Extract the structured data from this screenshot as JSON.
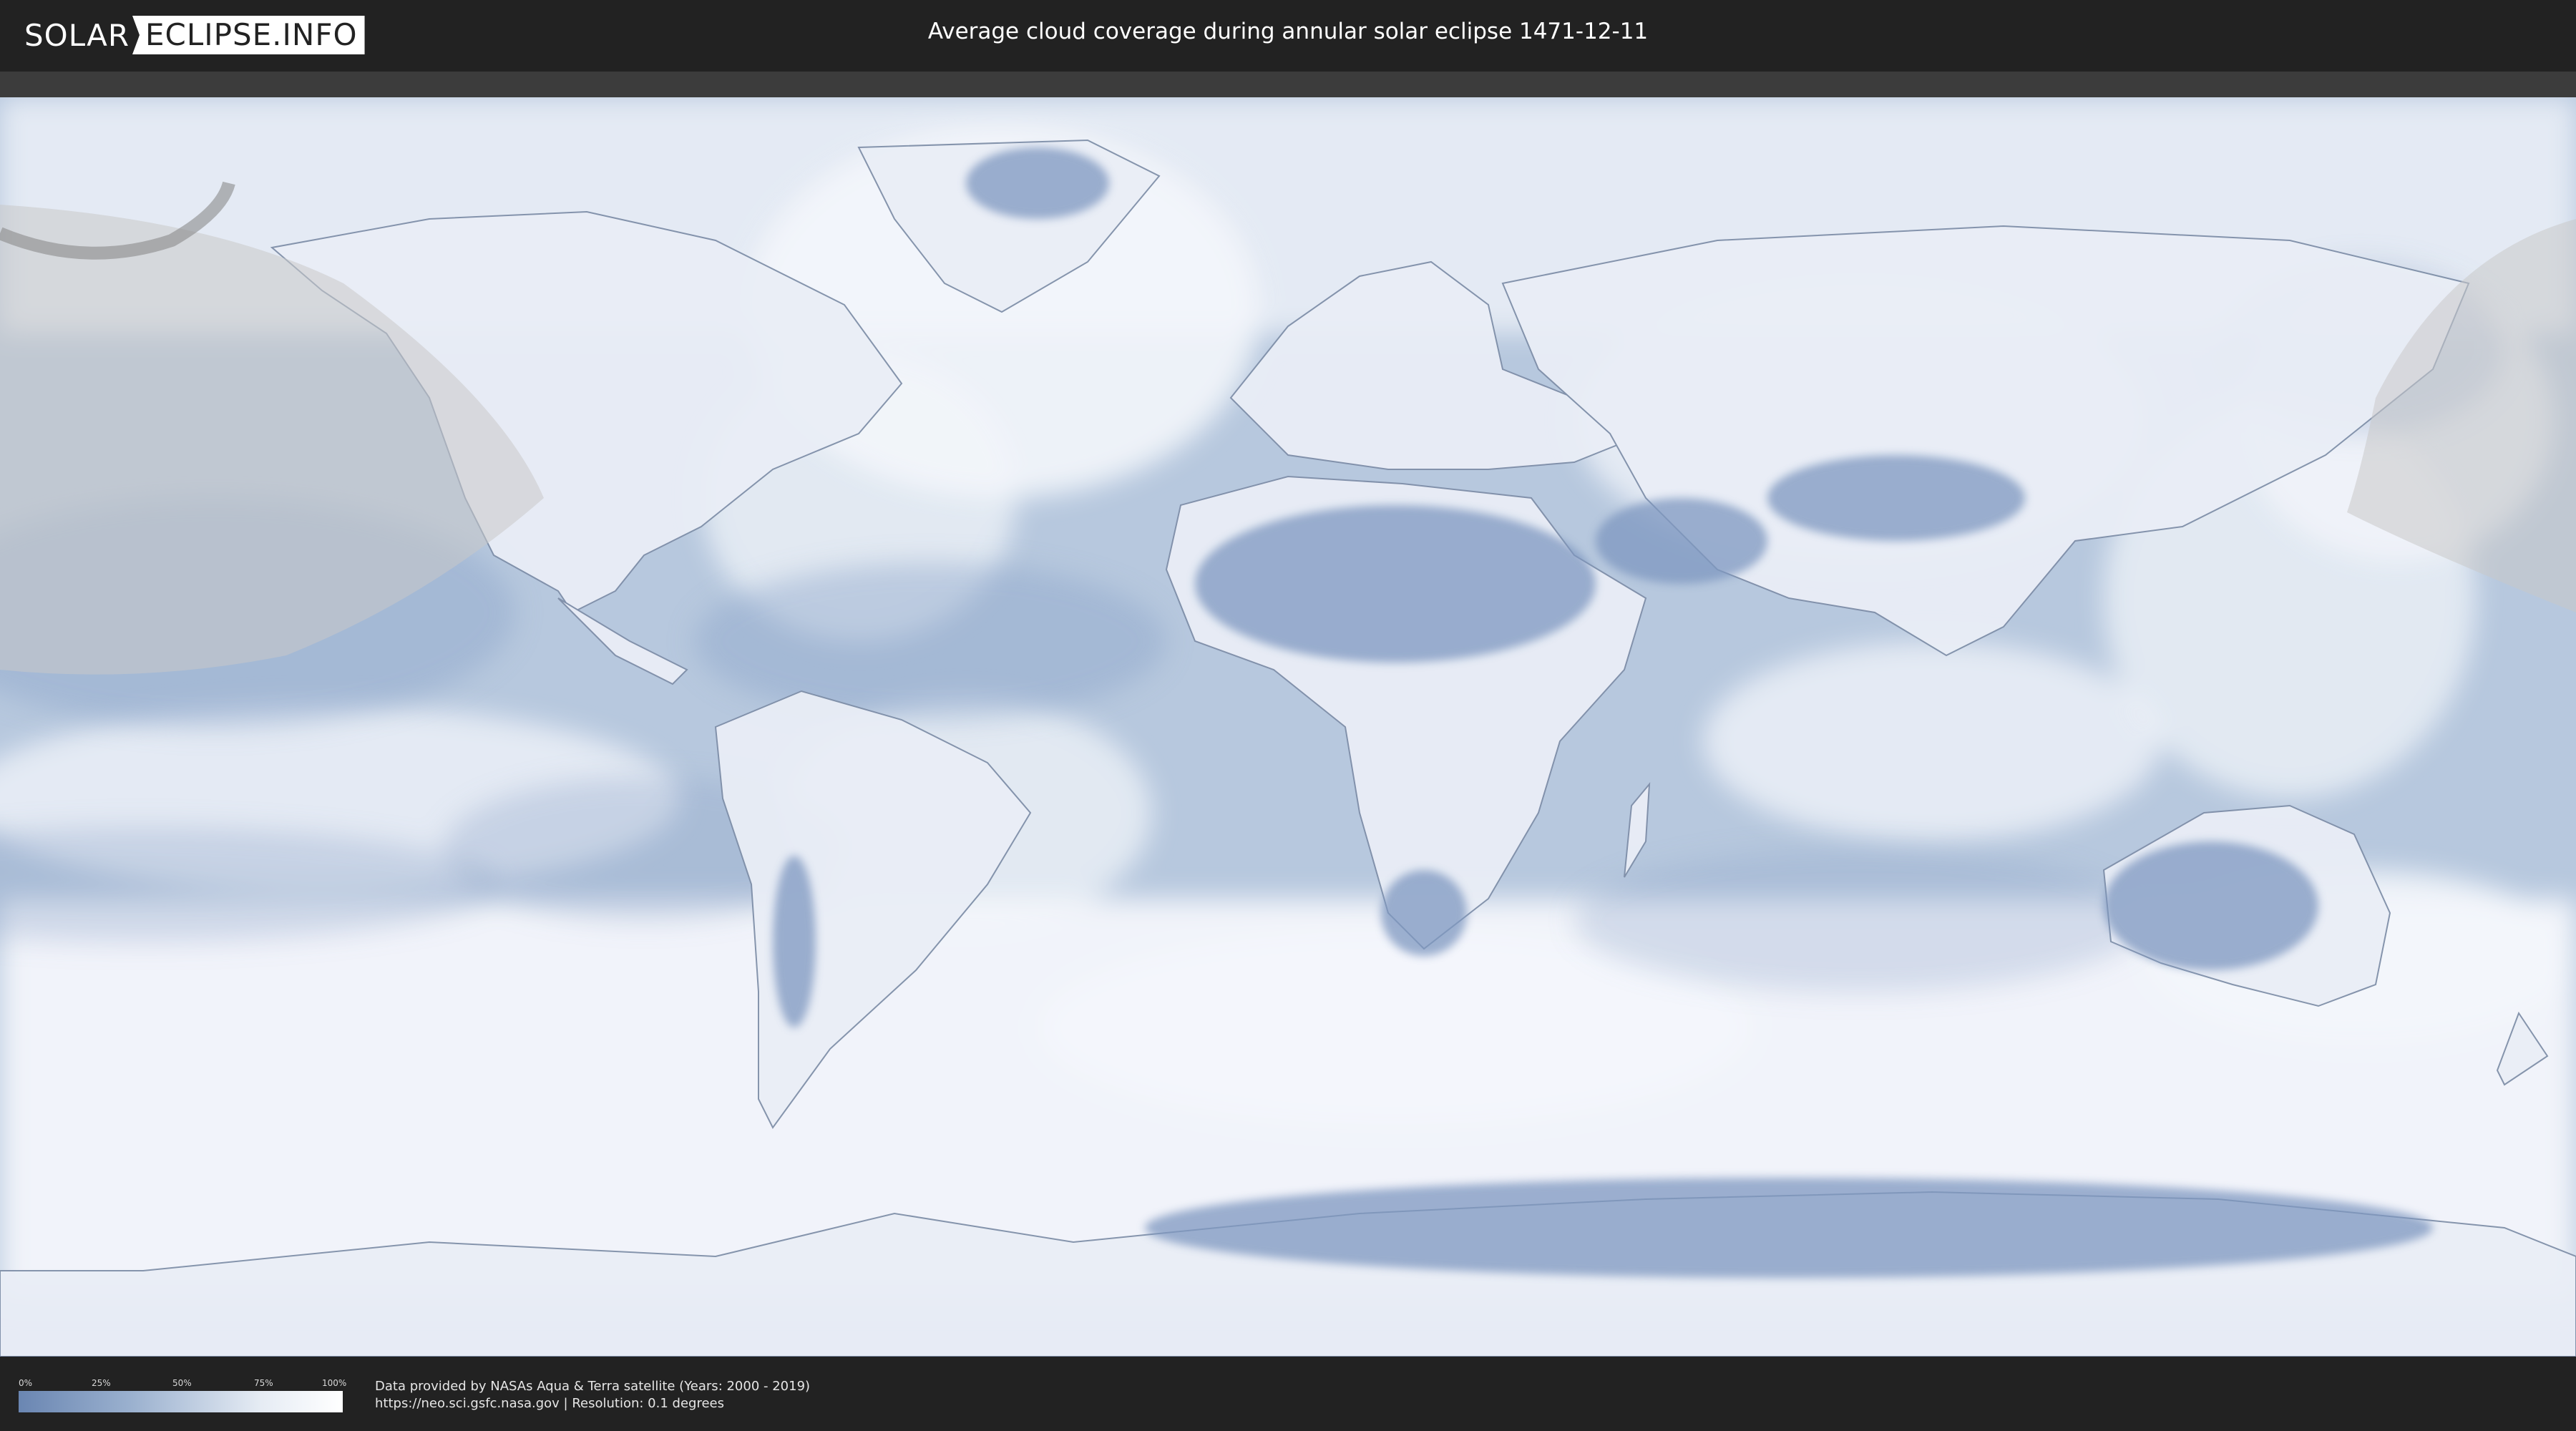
{
  "header": {
    "logo_left": "SOLAR",
    "logo_right": "ECLIPSE.INFO",
    "title": "Average cloud coverage during annular solar eclipse 1471-12-11"
  },
  "legend": {
    "ticks": [
      "0%",
      "25%",
      "50%",
      "75%",
      "100%"
    ],
    "colors": {
      "low": "#6a86b2",
      "mid": "#9bb1cf",
      "high": "#ffffff"
    }
  },
  "footer": {
    "credit_line1": "Data provided by NASAs Aqua & Terra satellite (Years: 2000 - 2019)",
    "credit_line2": "https://neo.sci.gsfc.nasa.gov | Resolution: 0.1 degrees"
  },
  "colors": {
    "ocean_clear": "#b5c7de",
    "cloud": "#f2f5fa",
    "land_dry": "#7f97bf",
    "eclipse_shade": "#c9c9c9",
    "background": "#222222"
  }
}
